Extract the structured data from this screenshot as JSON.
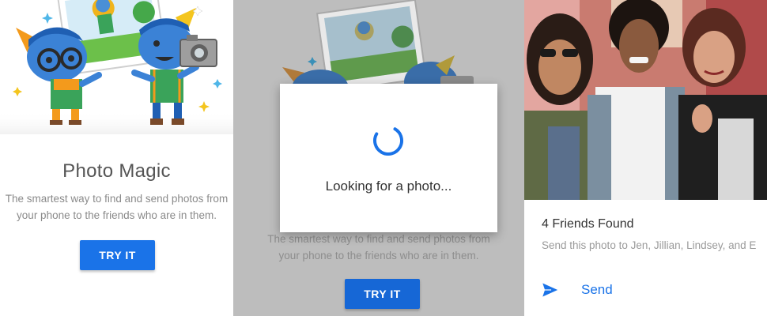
{
  "panels": [
    {
      "title": "Photo Magic",
      "description_line1": "The smartest way to find and send photos from",
      "description_line2": "your phone to the friends who are in them.",
      "button_label": "TRY IT"
    },
    {
      "dialog_text": "Looking for a photo...",
      "description_line1": "The smartest way to find and send photos from",
      "description_line2": "your phone to the friends who are in them.",
      "button_label": "TRY IT"
    },
    {
      "card_title": "4 Friends Found",
      "card_description": "Send this photo to Jen, Jillian, Lindsey, and E",
      "send_label": "Send"
    }
  ],
  "colors": {
    "accent": "#1a73e8",
    "scrim": "#bdbdbd"
  },
  "icons": [
    "camera-icon",
    "spinner-icon",
    "send-icon"
  ]
}
